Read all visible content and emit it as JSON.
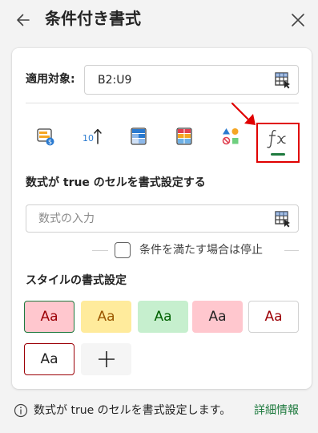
{
  "header": {
    "title": "条件付き書式",
    "back_icon": "arrow-left-icon",
    "close_icon": "close-icon"
  },
  "applies_to": {
    "label": "適用対象:",
    "value": "B2:U9",
    "picker_icon": "range-select-icon"
  },
  "rule_types": [
    {
      "name": "data-bar-icon",
      "selected": false
    },
    {
      "name": "top-bottom-icon",
      "label": "10"
    },
    {
      "name": "color-scale-icon",
      "selected": false
    },
    {
      "name": "highlight-cells-icon",
      "selected": false
    },
    {
      "name": "icon-set-icon",
      "selected": false
    },
    {
      "name": "formula-fx-icon",
      "selected": true,
      "glyph": "fx"
    }
  ],
  "formula": {
    "heading": "数式が true のセルを書式設定する",
    "placeholder": "数式の入力",
    "value": "",
    "picker_icon": "range-select-icon"
  },
  "stop_if_true": {
    "label": "条件を満たす場合は停止",
    "checked": false
  },
  "style": {
    "heading": "スタイルの書式設定",
    "swatches": [
      {
        "text": "Aa",
        "bg": "#ffc7ce",
        "fg": "#9c0006",
        "border": "#1e7a3e",
        "selected": true
      },
      {
        "text": "Aa",
        "bg": "#ffeb9c",
        "fg": "#9c5700",
        "border": "#ffeb9c"
      },
      {
        "text": "Aa",
        "bg": "#c6efce",
        "fg": "#006100",
        "border": "#c6efce"
      },
      {
        "text": "Aa",
        "bg": "#ffc7ce",
        "fg": "#242424",
        "border": "#ffc7ce"
      },
      {
        "text": "Aa",
        "bg": "#ffffff",
        "fg": "#9c0006",
        "border": "#d1d1d1"
      },
      {
        "text": "Aa",
        "bg": "#ffffff",
        "fg": "#242424",
        "border": "#9c0006"
      }
    ],
    "add_icon": "plus-icon"
  },
  "footer": {
    "info_icon": "info-icon",
    "text": "数式が true のセルを書式設定します。",
    "link": "詳細情報"
  },
  "colors": {
    "accent": "#1e7a3e",
    "annotation": "#e00000"
  }
}
